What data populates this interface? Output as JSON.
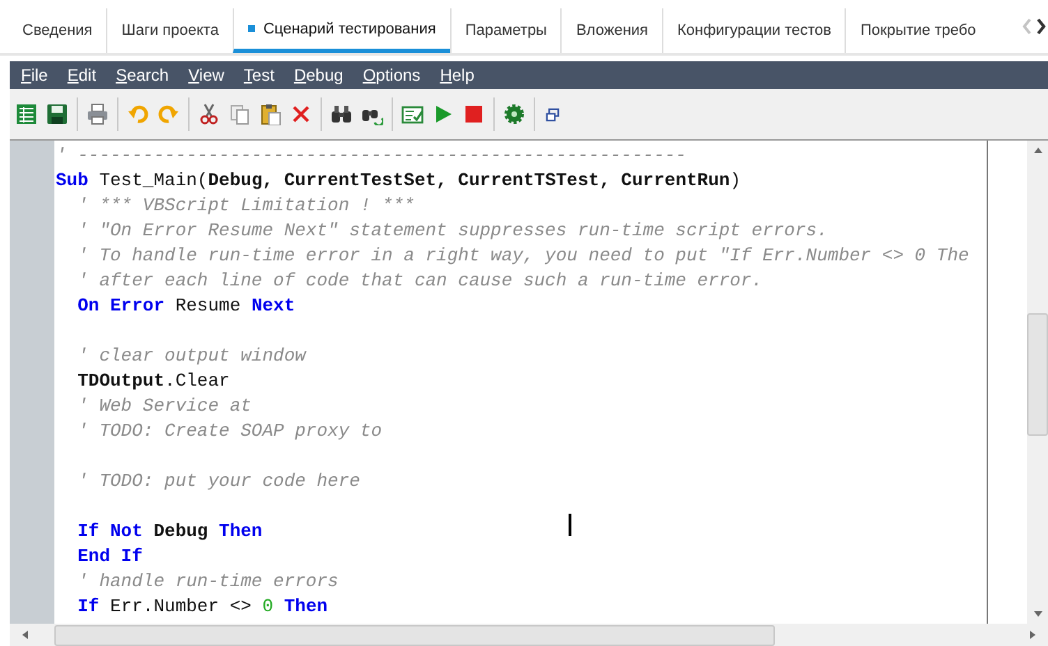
{
  "tabs": [
    {
      "label": "Сведения",
      "selected": false
    },
    {
      "label": "Шаги проекта",
      "selected": false
    },
    {
      "label": "Сценарий тестирования",
      "selected": true
    },
    {
      "label": "Параметры",
      "selected": false
    },
    {
      "label": "Вложения",
      "selected": false
    },
    {
      "label": "Конфигурации тестов",
      "selected": false
    },
    {
      "label": "Покрытие требо",
      "selected": false
    }
  ],
  "menu": [
    "File",
    "Edit",
    "Search",
    "View",
    "Test",
    "Debug",
    "Options",
    "Help"
  ],
  "editor": {
    "lines": [
      {
        "kind": "code",
        "tokens": [
          {
            "kind": "comment",
            "text": "' --------------------------------------------------------"
          }
        ]
      },
      {
        "kind": "code",
        "tokens": [
          {
            "kind": "keyword",
            "text": "Sub"
          },
          {
            "kind": "plain",
            "text": " Test_Main("
          },
          {
            "kind": "ident",
            "text": "Debug, CurrentTestSet, CurrentTSTest, CurrentRun"
          },
          {
            "kind": "plain",
            "text": ")"
          }
        ]
      },
      {
        "kind": "code",
        "tokens": [
          {
            "kind": "comment",
            "text": "  ' *** VBScript Limitation ! ***"
          }
        ]
      },
      {
        "kind": "code",
        "tokens": [
          {
            "kind": "comment",
            "text": "  ' \"On Error Resume Next\" statement suppresses run-time script errors."
          }
        ]
      },
      {
        "kind": "code",
        "tokens": [
          {
            "kind": "comment",
            "text": "  ' To handle run-time error in a right way, you need to put \"If Err.Number <> 0 The"
          }
        ]
      },
      {
        "kind": "code",
        "tokens": [
          {
            "kind": "comment",
            "text": "  ' after each line of code that can cause such a run-time error."
          }
        ]
      },
      {
        "kind": "code",
        "tokens": [
          {
            "kind": "keyword",
            "text": "  On Error"
          },
          {
            "kind": "plain",
            "text": " Resume "
          },
          {
            "kind": "keyword",
            "text": "Next"
          }
        ]
      },
      {
        "kind": "blank"
      },
      {
        "kind": "code",
        "tokens": [
          {
            "kind": "comment",
            "text": "  ' clear output window"
          }
        ]
      },
      {
        "kind": "code",
        "tokens": [
          {
            "kind": "ident",
            "text": "  TDOutput"
          },
          {
            "kind": "plain",
            "text": ".Clear"
          }
        ]
      },
      {
        "kind": "code",
        "tokens": [
          {
            "kind": "comment",
            "text": "  ' Web Service at"
          }
        ]
      },
      {
        "kind": "code",
        "tokens": [
          {
            "kind": "comment",
            "text": "  ' TODO: Create SOAP proxy to"
          }
        ]
      },
      {
        "kind": "blank"
      },
      {
        "kind": "code",
        "tokens": [
          {
            "kind": "comment",
            "text": "  ' TODO: put your code here"
          }
        ]
      },
      {
        "kind": "blank"
      },
      {
        "kind": "code",
        "tokens": [
          {
            "kind": "keyword",
            "text": "  If Not"
          },
          {
            "kind": "ident",
            "text": " Debug "
          },
          {
            "kind": "keyword",
            "text": "Then"
          }
        ]
      },
      {
        "kind": "code",
        "tokens": [
          {
            "kind": "keyword",
            "text": "  End If"
          }
        ]
      },
      {
        "kind": "code",
        "tokens": [
          {
            "kind": "comment",
            "text": "  ' handle run-time errors"
          }
        ]
      },
      {
        "kind": "code",
        "tokens": [
          {
            "kind": "keyword",
            "text": "  If"
          },
          {
            "kind": "plain",
            "text": " Err.Number <> "
          },
          {
            "kind": "number",
            "text": "0"
          },
          {
            "kind": "keyword",
            "text": " Then"
          }
        ]
      }
    ]
  }
}
